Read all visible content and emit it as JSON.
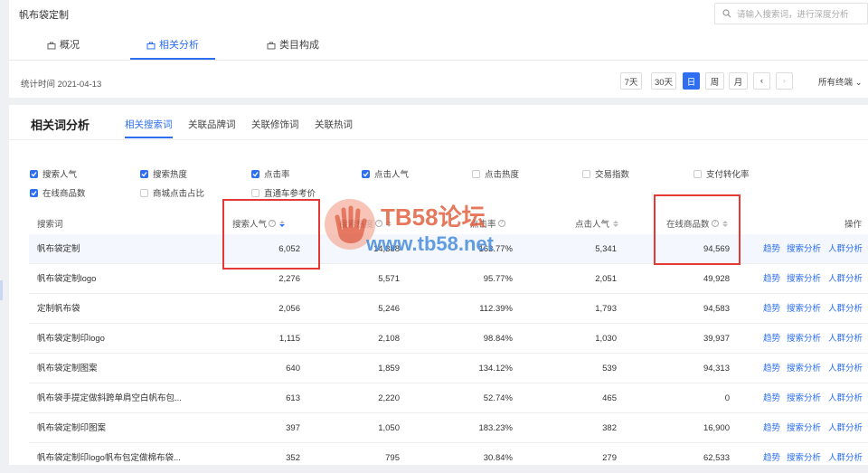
{
  "header": {
    "title": "帆布袋定制",
    "search_placeholder": "请输入搜索词，进行深度分析"
  },
  "tabs": [
    {
      "label": "概况"
    },
    {
      "label": "相关分析"
    },
    {
      "label": "类目构成"
    }
  ],
  "date_bar": {
    "date_text": "统计时间 2021-04-13",
    "buttons": [
      "7天",
      "30天",
      "日",
      "周",
      "月"
    ],
    "terminal": "所有终端"
  },
  "section": {
    "title": "相关词分析",
    "subtabs": [
      "相关搜索词",
      "关联品牌词",
      "关联修饰词",
      "关联热词"
    ]
  },
  "checkboxes": [
    {
      "label": "搜索人气",
      "checked": true
    },
    {
      "label": "搜索热度",
      "checked": true
    },
    {
      "label": "点击率",
      "checked": true
    },
    {
      "label": "点击人气",
      "checked": true
    },
    {
      "label": "点击热度",
      "checked": false
    },
    {
      "label": "交易指数",
      "checked": false
    },
    {
      "label": "支付转化率",
      "checked": false
    },
    {
      "label": "在线商品数",
      "checked": true
    },
    {
      "label": "商城点击占比",
      "checked": false
    },
    {
      "label": "直通车参考价",
      "checked": false
    }
  ],
  "table": {
    "headers": [
      "搜索词",
      "搜索人气",
      "搜索热度",
      "点击率",
      "点击人气",
      "在线商品数",
      "操作"
    ],
    "rows": [
      {
        "keyword": "帆布袋定制",
        "popularity": "6,052",
        "heat": "14,388",
        "ctr": "163.77%",
        "click_pop": "5,341",
        "online": "94,569"
      },
      {
        "keyword": "帆布袋定制logo",
        "popularity": "2,276",
        "heat": "5,571",
        "ctr": "95.77%",
        "click_pop": "2,051",
        "online": "49,928"
      },
      {
        "keyword": "定制帆布袋",
        "popularity": "2,056",
        "heat": "5,246",
        "ctr": "112.39%",
        "click_pop": "1,793",
        "online": "94,583"
      },
      {
        "keyword": "帆布袋定制印logo",
        "popularity": "1,115",
        "heat": "2,108",
        "ctr": "98.84%",
        "click_pop": "1,030",
        "online": "39,937"
      },
      {
        "keyword": "帆布袋定制图案",
        "popularity": "640",
        "heat": "1,859",
        "ctr": "134.12%",
        "click_pop": "539",
        "online": "94,313"
      },
      {
        "keyword": "帆布袋手提定做斜跨单肩空白帆布包...",
        "popularity": "613",
        "heat": "2,220",
        "ctr": "52.74%",
        "click_pop": "465",
        "online": "0"
      },
      {
        "keyword": "帆布袋定制印图案",
        "popularity": "397",
        "heat": "1,050",
        "ctr": "183.23%",
        "click_pop": "382",
        "online": "16,900"
      },
      {
        "keyword": "帆布袋定制印logo帆布包定做棉布袋...",
        "popularity": "352",
        "heat": "795",
        "ctr": "30.84%",
        "click_pop": "279",
        "online": "62,533"
      }
    ],
    "actions": [
      "趋势",
      "搜索分析",
      "人群分析"
    ]
  },
  "watermark": {
    "title": "TB58论坛",
    "url": "www.tb58.net"
  }
}
